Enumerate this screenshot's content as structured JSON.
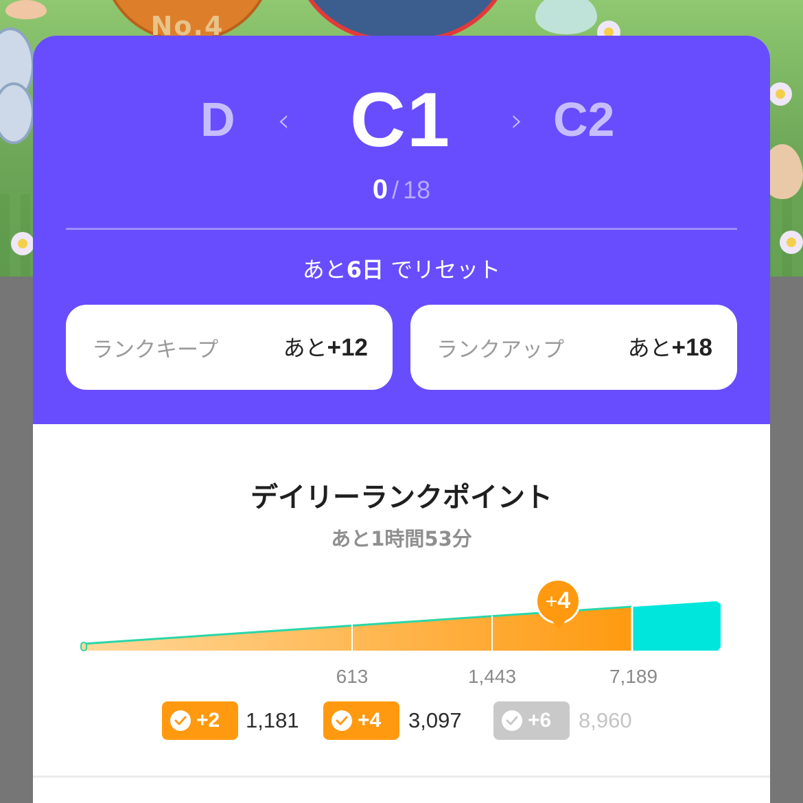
{
  "background": {
    "badge_label": "No.4"
  },
  "rank": {
    "prev": "D",
    "current": "C1",
    "next": "C2",
    "prev_chevron": "‹",
    "next_chevron": "›",
    "score_current": "0",
    "score_separator": "/",
    "score_max": "18"
  },
  "reset": {
    "prefix": "あと",
    "days": "6日",
    "suffix": " でリセット"
  },
  "cards": {
    "keep": {
      "label": "ランクキープ",
      "prefix": "あと",
      "value": "+12"
    },
    "up": {
      "label": "ランクアップ",
      "prefix": "あと",
      "value": "+18"
    }
  },
  "daily": {
    "title": "デイリーランクポイント",
    "remaining": "あと1時間53分",
    "current_bonus": {
      "plus": "+",
      "value": "4"
    },
    "ticks": [
      "613",
      "1,443",
      "7,189"
    ],
    "progress_fraction": 0.86,
    "rewards": [
      {
        "label": "+2",
        "threshold": "1,181",
        "achieved": true
      },
      {
        "label": "+4",
        "threshold": "3,097",
        "achieved": true
      },
      {
        "label": "+6",
        "threshold": "8,960",
        "achieved": false
      }
    ]
  },
  "colors": {
    "accent_purple": "#684dfe",
    "progress_orange": "#ff9a10",
    "progress_teal": "#00e6dc",
    "chip_inactive": "#c9c9c9"
  }
}
